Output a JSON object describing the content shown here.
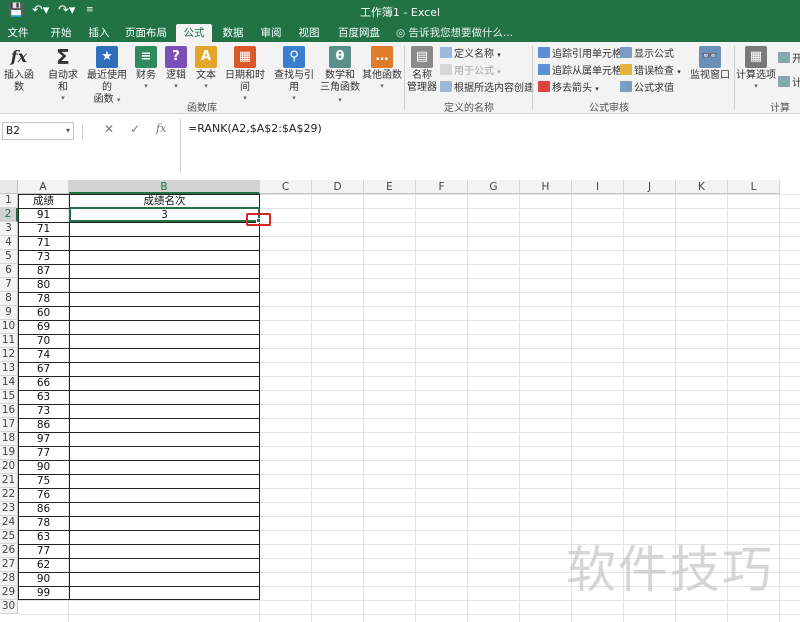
{
  "window": {
    "title": "工作簿1 - Excel"
  },
  "tabs": [
    "文件",
    "开始",
    "插入",
    "页面布局",
    "公式",
    "数据",
    "审阅",
    "视图",
    "百度网盘"
  ],
  "active_tab": "公式",
  "tell_me": "告诉我您想要做什么...",
  "ribbon": {
    "function_library": {
      "insert_function": "插入函数",
      "autosum": "自动求和",
      "recent": [
        "最近使用的",
        "函数"
      ],
      "financial": "财务",
      "logical": "逻辑",
      "text": "文本",
      "datetime": "日期和时间",
      "lookup": "查找与引用",
      "math": [
        "数学和",
        "三角函数"
      ],
      "more": "其他函数",
      "group_label": "函数库"
    },
    "defined_names": {
      "name_manager": [
        "名称",
        "管理器"
      ],
      "define_name": "定义名称",
      "use_in_formula": "用于公式",
      "create_from_selection": "根据所选内容创建",
      "group_label": "定义的名称"
    },
    "formula_auditing": {
      "trace_precedents": "追踪引用单元格",
      "trace_dependents": "追踪从属单元格",
      "remove_arrows": "移去箭头",
      "show_formulas": "显示公式",
      "error_checking": "错误检查",
      "evaluate_formula": "公式求值",
      "group_label": "公式审核"
    },
    "watch_window": "监视窗口",
    "calculation": {
      "options": "计算选项",
      "start": "开",
      "calc": "计",
      "group_label": "计算"
    }
  },
  "formula_bar": {
    "name_box": "B2",
    "formula": "=RANK(A2,$A$2:$A$29)"
  },
  "sheet": {
    "columns": [
      "A",
      "B",
      "C",
      "D",
      "E",
      "F",
      "G",
      "H",
      "I",
      "J",
      "K",
      "L"
    ],
    "rows": [
      "1",
      "2",
      "3",
      "4",
      "5",
      "6",
      "7",
      "8",
      "9",
      "10",
      "11",
      "12",
      "13",
      "14",
      "15",
      "16",
      "17",
      "18",
      "19",
      "20",
      "21",
      "22",
      "23",
      "24",
      "25",
      "26",
      "27",
      "28",
      "29",
      "30"
    ],
    "header_a": "成绩",
    "header_b": "成绩名次",
    "scores": [
      "91",
      "71",
      "71",
      "73",
      "87",
      "80",
      "78",
      "60",
      "69",
      "70",
      "74",
      "67",
      "66",
      "63",
      "73",
      "86",
      "97",
      "77",
      "90",
      "75",
      "76",
      "86",
      "78",
      "63",
      "77",
      "62",
      "90",
      "99"
    ],
    "rank_b2": "3"
  },
  "watermark": "软件技巧"
}
